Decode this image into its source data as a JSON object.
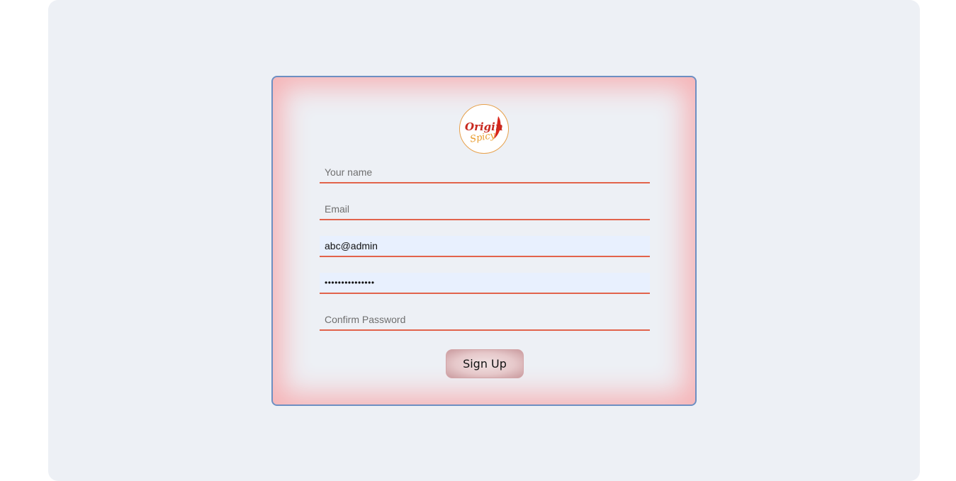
{
  "logo": {
    "text_top": "Origin",
    "text_bottom": "Spicy"
  },
  "form": {
    "name": {
      "placeholder": "Your name",
      "value": ""
    },
    "email": {
      "placeholder": "Email",
      "value": ""
    },
    "username": {
      "placeholder": "",
      "value": "abc@admin"
    },
    "password": {
      "placeholder": "",
      "value": "•••••••••••••••"
    },
    "confirm_password": {
      "placeholder": "Confirm Password",
      "value": ""
    },
    "submit_label": "Sign Up"
  },
  "colors": {
    "page_background": "#edf0f5",
    "card_border": "#6d8fc2",
    "card_glow": "#f6b3b6",
    "field_underline": "#e2634b",
    "autofill_background": "#e8f0fe"
  }
}
